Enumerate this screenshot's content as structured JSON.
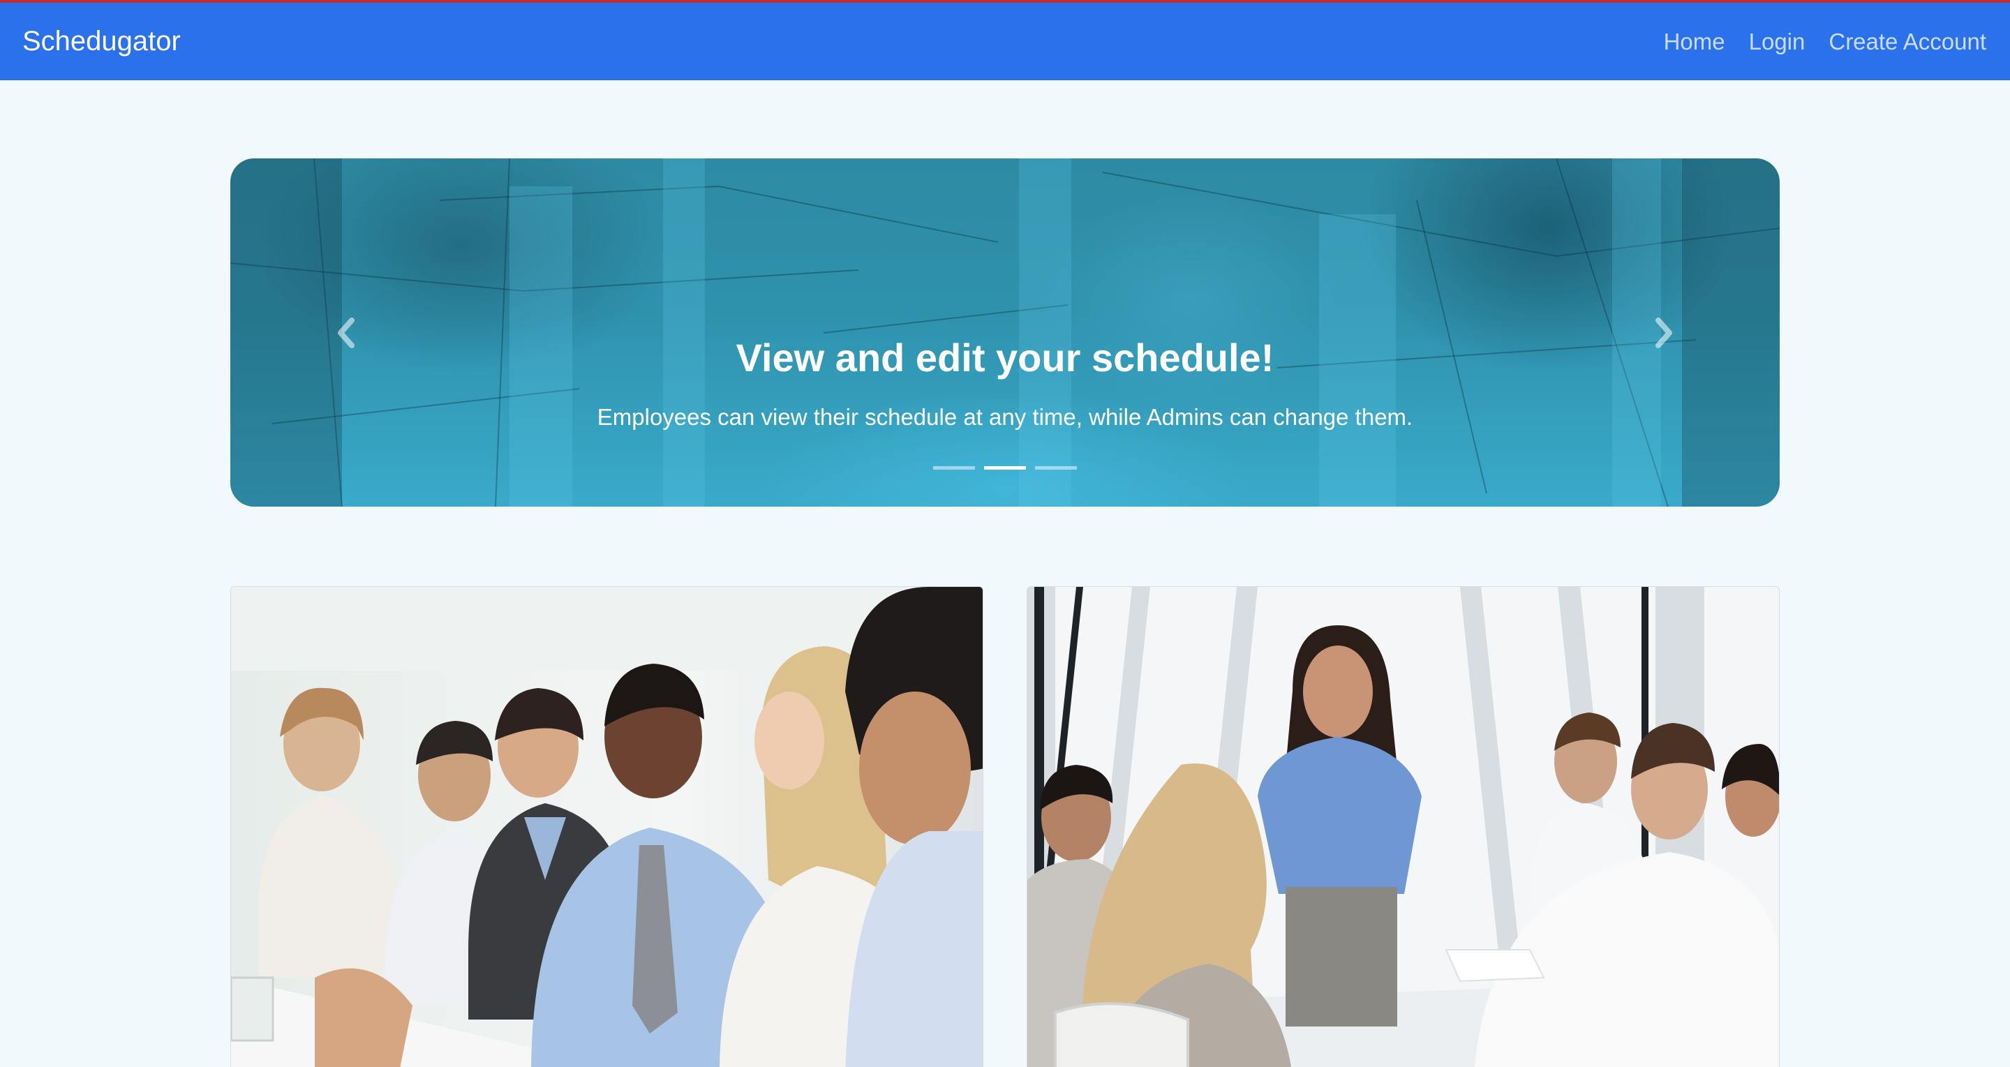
{
  "navbar": {
    "brand": "Schedugator",
    "links": [
      "Home",
      "Login",
      "Create Account"
    ]
  },
  "carousel": {
    "title": "View and edit your schedule!",
    "text": "Employees can view their schedule at any time, while Admins can change them.",
    "slide_count": 3,
    "active_index": 1,
    "prev_icon": "chevron-left-icon",
    "next_icon": "chevron-right-icon"
  },
  "colors": {
    "navbar": "#2b71eb",
    "page_background": "#f1f9fd",
    "carousel_teal": "#2f92ad"
  }
}
